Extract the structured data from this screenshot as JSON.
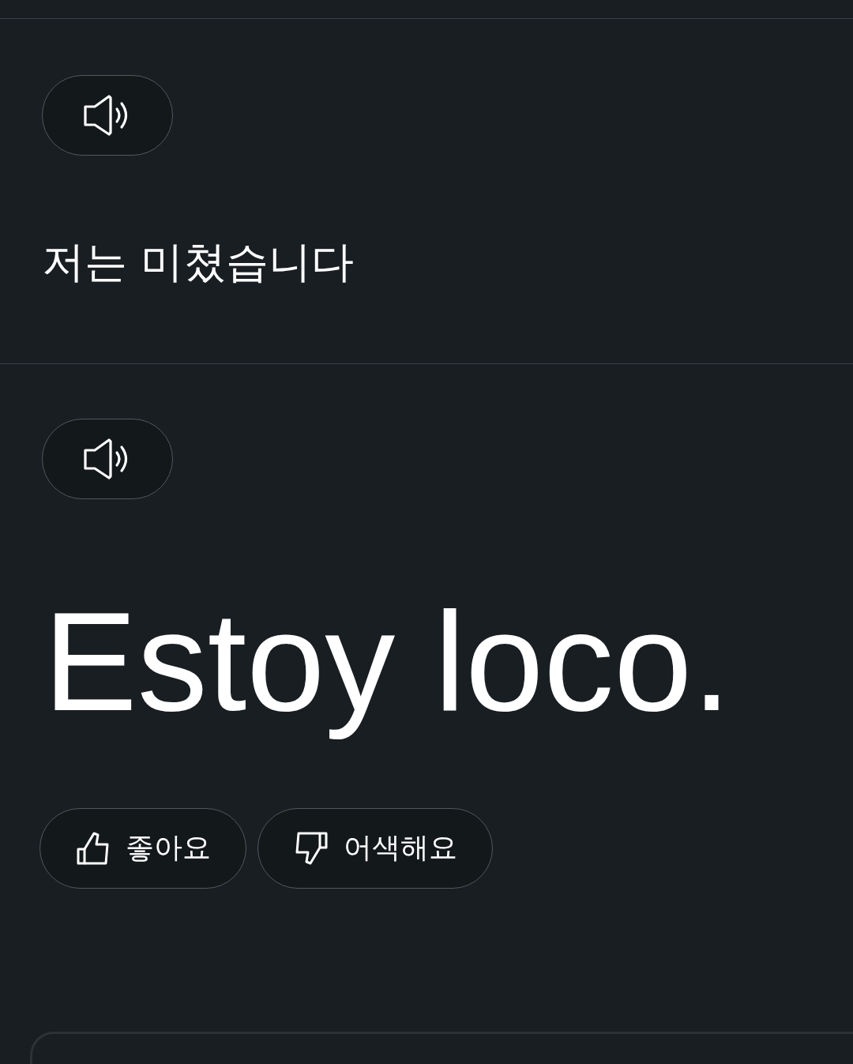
{
  "source": {
    "text": "저는 미쳤습니다"
  },
  "translation": {
    "text": "Estoy loco."
  },
  "feedback": [
    {
      "kind": "like",
      "label": "좋아요"
    },
    {
      "kind": "dislike",
      "label": "어색해요"
    }
  ]
}
